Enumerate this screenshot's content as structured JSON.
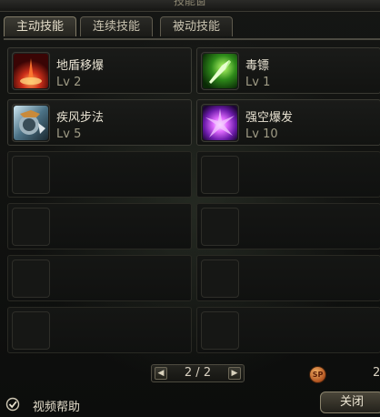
{
  "window": {
    "title": "技能窗"
  },
  "tabs": [
    {
      "label": "主动技能"
    },
    {
      "label": "连续技能"
    },
    {
      "label": "被动技能"
    }
  ],
  "skills": [
    {
      "name": "地盾移爆",
      "level": "Lv 2",
      "icon": "earth-shield-icon"
    },
    {
      "name": "毒镖",
      "level": "Lv 1",
      "icon": "poison-dart-icon"
    },
    {
      "name": "疾风步法",
      "level": "Lv 5",
      "icon": "gale-step-icon"
    },
    {
      "name": "强空爆发",
      "level": "Lv 10",
      "icon": "void-burst-icon"
    }
  ],
  "empty_slot_count": 8,
  "pager": {
    "text": "2 / 2",
    "prev_icon": "triangle-left-icon",
    "next_icon": "triangle-right-icon"
  },
  "sp": {
    "label": "SP",
    "value": "2"
  },
  "footer": {
    "video_help_label": "视频帮助",
    "video_help_checked": true,
    "close_label": "关闭"
  },
  "colors": {
    "accent": "#a09c86",
    "text": "#e8e2d2",
    "background": "#0f100f"
  }
}
